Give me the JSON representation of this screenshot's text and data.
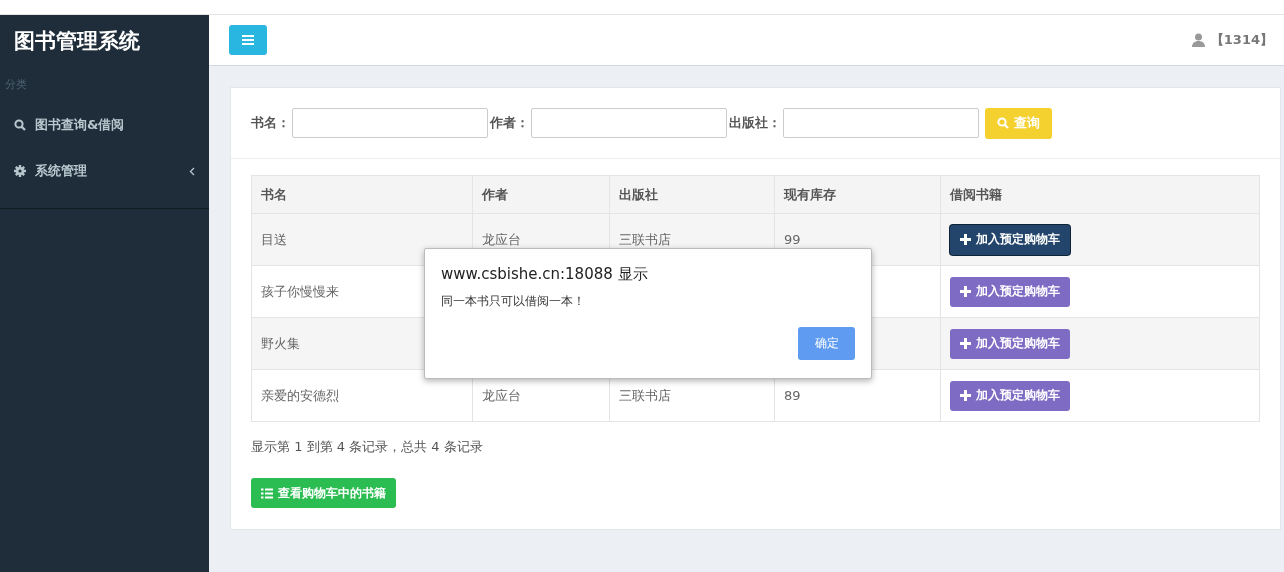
{
  "sidebar": {
    "title": "图书管理系统",
    "section": "分类",
    "items": [
      {
        "kind": "search",
        "label": "图书查询&借阅",
        "expandable": false
      },
      {
        "kind": "settings",
        "label": "系统管理",
        "expandable": true
      }
    ]
  },
  "header": {
    "user": "【1314】"
  },
  "search": {
    "fields": [
      {
        "label": "书名："
      },
      {
        "label": "作者："
      },
      {
        "label": "出版社："
      }
    ],
    "button": "查询"
  },
  "table": {
    "columns": [
      "书名",
      "作者",
      "出版社",
      "现有库存",
      "借阅书籍"
    ],
    "rows": [
      {
        "name": "目送",
        "author": "龙应台",
        "publisher": "三联书店",
        "stock": "99",
        "action": "加入预定购物车",
        "focused": true
      },
      {
        "name": "孩子你慢慢来",
        "action": "加入预定购物车",
        "focused": false
      },
      {
        "name": "野火集",
        "action": "加入预定购物车",
        "focused": false
      },
      {
        "name": "亲爱的安德烈",
        "author": "龙应台",
        "publisher": "三联书店",
        "stock": "89",
        "action": "加入预定购物车",
        "focused": false
      }
    ]
  },
  "pagination": "显示第 1 到第 4 条记录，总共 4 条记录",
  "cart_button": "查看购物车中的书籍",
  "dialog": {
    "title": "www.csbishe.cn:18088 显示",
    "message": "同一本书只可以借阅一本！",
    "ok": "确定"
  }
}
